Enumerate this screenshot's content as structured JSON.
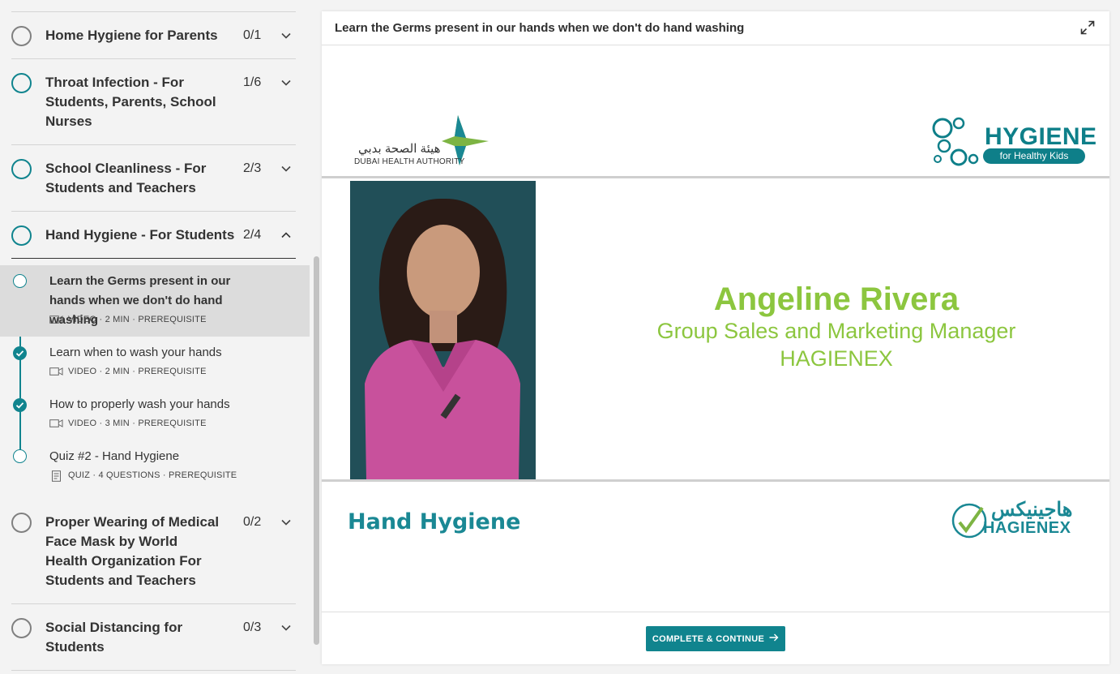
{
  "sidebar": {
    "chapters": [
      {
        "title": "Home Hygiene for Parents",
        "count": "0/1",
        "expanded": false
      },
      {
        "title": "Throat Infection - For Students, Parents, School Nurses",
        "count": "1/6",
        "expanded": false
      },
      {
        "title": "School Cleanliness - For Students and Teachers",
        "count": "2/3",
        "expanded": false
      },
      {
        "title": "Hand Hygiene - For Students",
        "count": "2/4",
        "expanded": true
      },
      {
        "title": "Proper Wearing of Medical Face Mask by World Health Organization For Students and Teachers",
        "count": "0/2",
        "expanded": false
      },
      {
        "title": "Social Distancing for Students",
        "count": "0/3",
        "expanded": false
      }
    ],
    "lessons": [
      {
        "title": "Learn the Germs present in our hands when we don't do hand washing",
        "meta": "VIDEO · 2 MIN · PREREQUISITE",
        "status": "current",
        "type": "video"
      },
      {
        "title": "Learn when to wash your hands",
        "meta": "VIDEO · 2 MIN · PREREQUISITE",
        "status": "complete",
        "type": "video"
      },
      {
        "title": "How to properly wash your hands",
        "meta": "VIDEO · 3 MIN · PREREQUISITE",
        "status": "complete",
        "type": "video"
      },
      {
        "title": "Quiz #2 - Hand Hygiene",
        "meta": "QUIZ · 4 QUESTIONS · PREREQUISITE",
        "status": "incomplete",
        "type": "quiz"
      }
    ]
  },
  "main": {
    "title": "Learn the Germs present in our hands when we don't do hand washing",
    "video": {
      "presenter_name": "Angeline Rivera",
      "presenter_role": "Group Sales and Marketing Manager",
      "presenter_company": "HAGIENEX",
      "dha_arabic": "هيئة الصحة بدبي",
      "dha_english": "DUBAI HEALTH AUTHORITY",
      "hygiene_logo_word": "HYGIENE",
      "hygiene_logo_tag": "for Healthy Kids",
      "bottom_title": "Hand Hygiene",
      "hagienex_arabic": "هاجينيكس",
      "hagienex_english": "HAGIENEX"
    },
    "cta_label": "COMPLETE & CONTINUE"
  },
  "colors": {
    "accent": "#10848e",
    "brand_green": "#8cc63f"
  }
}
